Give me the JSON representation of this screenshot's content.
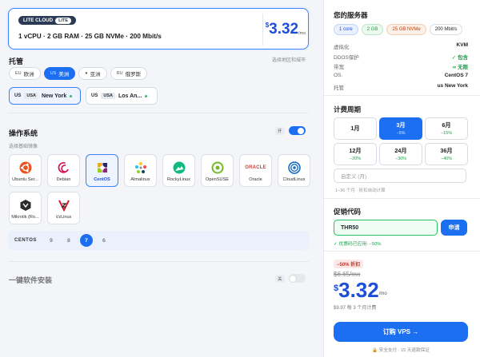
{
  "plan": {
    "badge": "LITE CLOUD",
    "badge_sub": "LITE",
    "spec": "1 vCPU · 2 GB RAM · 25 GB NVMe · 200 Mbit/s",
    "price_currency": "$",
    "price": "3.32",
    "price_per": "/mo"
  },
  "hosting": {
    "title": "托管",
    "hint": "选择地区和城市",
    "regions": [
      {
        "code": "EU",
        "label": "欧洲",
        "active": false
      },
      {
        "code": "US",
        "label": "美洲",
        "active": true
      },
      {
        "code": "",
        "label": "亚洲",
        "active": false
      },
      {
        "code": "RU",
        "label": "俄罗斯",
        "active": false
      }
    ],
    "locations": [
      {
        "flag": "US",
        "code": "USA",
        "city": "New York",
        "selected": true
      },
      {
        "flag": "US",
        "code": "USA",
        "city": "Los An...",
        "selected": false
      }
    ]
  },
  "os": {
    "title": "操作系统",
    "toggle_label": "开",
    "subtitle": "选择基础镜像",
    "items": [
      {
        "name": "Ubuntu Ser...",
        "icon": "ubuntu-icon",
        "selected": false
      },
      {
        "name": "Debian",
        "icon": "debian-icon",
        "selected": false
      },
      {
        "name": "CentOS",
        "icon": "centos-icon",
        "selected": true
      },
      {
        "name": "Almalinux",
        "icon": "almalinux-icon",
        "selected": false
      },
      {
        "name": "RockyLinux",
        "icon": "rockylinux-icon",
        "selected": false
      },
      {
        "name": "OpenSUSE",
        "icon": "opensuse-icon",
        "selected": false
      },
      {
        "name": "Oracle",
        "icon": "oracle-icon",
        "selected": false
      },
      {
        "name": "CloudLinux",
        "icon": "cloudlinux-icon",
        "selected": false
      },
      {
        "name": "Mikrotik (Ro...",
        "icon": "mikrotik-icon",
        "selected": false
      },
      {
        "name": "VzLinux",
        "icon": "vzlinux-icon",
        "selected": false
      }
    ],
    "version_label": "CENTOS",
    "versions": [
      "9",
      "8",
      "7",
      "6"
    ],
    "selected_version": "7"
  },
  "software": {
    "title": "一键软件安装",
    "toggle_label": "关"
  },
  "summary": {
    "title": "您的服务器",
    "chips": [
      {
        "label": "1 core",
        "color": "#1d6ff2"
      },
      {
        "label": "2 GB",
        "color": "#16a34a"
      },
      {
        "label": "25 GB NVMe",
        "color": "#ea580c"
      },
      {
        "label": "200 Mbit/s",
        "color": "#222222"
      }
    ],
    "specs": [
      {
        "k": "虚拟化",
        "v": "KVM"
      },
      {
        "k": "DDOS保护",
        "v": "✓ 包含"
      },
      {
        "k": "带宽",
        "v": "∞ 无限"
      },
      {
        "k": "OS.",
        "v": "CentOS 7"
      },
      {
        "k": "托管",
        "v": "us New York"
      }
    ]
  },
  "billing": {
    "title": "计费周期",
    "periods": [
      {
        "label": "1月",
        "discount": "",
        "selected": false
      },
      {
        "label": "3月",
        "discount": "−5%",
        "selected": true
      },
      {
        "label": "6月",
        "discount": "−15%",
        "selected": false
      },
      {
        "label": "12月",
        "discount": "−20%",
        "selected": false
      },
      {
        "label": "24月",
        "discount": "−30%",
        "selected": false
      },
      {
        "label": "36月",
        "discount": "−40%",
        "selected": false
      }
    ],
    "custom_placeholder": "自定义 (月)",
    "custom_hint": "1–36 个月 · 折扣自动计算"
  },
  "promo": {
    "title": "促销代码",
    "value": "THR50",
    "apply_label": "申请",
    "applied_msg": "✓ 优惠码已应用: −50%"
  },
  "total": {
    "discount_badge": "−50% 折扣",
    "old_price": "$6.65/mo",
    "currency": "$",
    "price": "3.32",
    "per": "/mo",
    "billed_note": "$9.97 每 3 个月计费",
    "order_label": "订购 VPS →",
    "footer_note": "安全支付 · 15 天退款保证"
  }
}
